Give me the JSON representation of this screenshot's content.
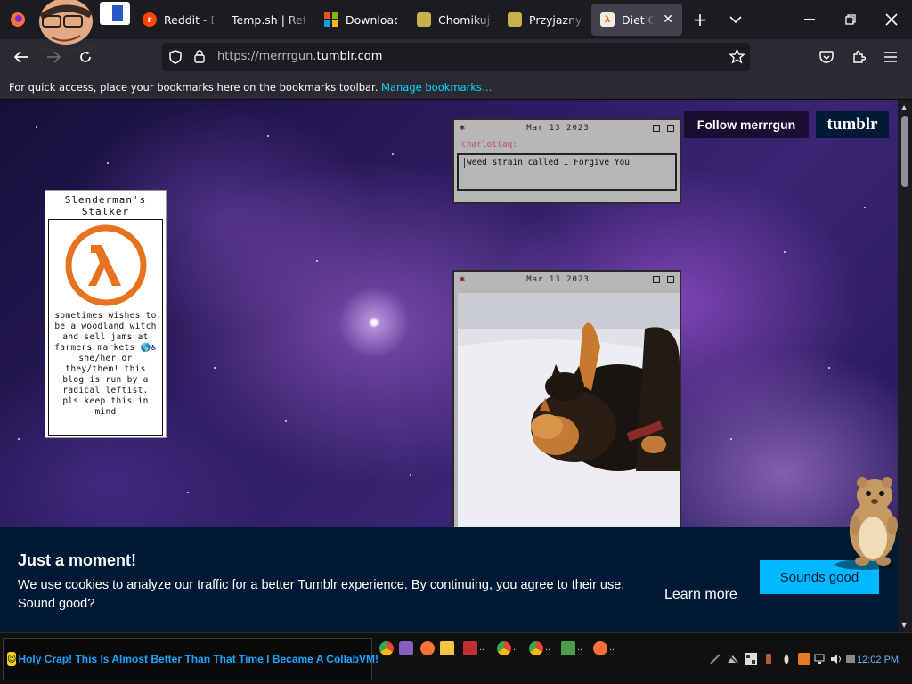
{
  "browser": {
    "tabs": [
      {
        "label": "Reddit - Dive into anything",
        "favicon": "reddit-icon",
        "color": "#ff4500"
      },
      {
        "label": "Temp.sh | Retro",
        "favicon": "tempsh-icon",
        "color": "#1c1b22"
      },
      {
        "label": "Download",
        "favicon": "microsoft-icon",
        "color": "#f25022"
      },
      {
        "label": "Chomikuj.pl",
        "favicon": "chomikuj-icon",
        "color": "#c8b14a"
      },
      {
        "label": "Przyjazny dysk",
        "favicon": "przyjazny-icon",
        "color": "#c8b14a"
      },
      {
        "label": "Diet Coke",
        "favicon": "halflife-icon",
        "color": "#e8e0d0",
        "active": true
      }
    ],
    "new_tab_label": "+",
    "url": {
      "prefix": "https://merrrgun.",
      "domain": "tumblr.com"
    },
    "bookmarks_text": "For quick access, place your bookmarks here on the bookmarks toolbar.",
    "bookmarks_link": "Manage bookmarks…"
  },
  "page": {
    "sidebar": {
      "title": "Slenderman's Stalker",
      "description": "sometimes wishes to be a woodland witch and sell jams at farmers markets 🌎♿ she/her or they/them! this blog is run by a radical leftist. pls keep this in mind"
    },
    "post1": {
      "date": "Mar 13 2023",
      "author": "charlottaq:",
      "quote": "weed strain called I Forgive You"
    },
    "post2": {
      "date": "Mar 13 2023"
    },
    "follow_label": "Follow merrrgun",
    "tumblr_logo": "tumblr",
    "cookie": {
      "title": "Just a moment!",
      "body": "We use cookies to analyze our traffic for a better Tumblr experience. By continuing, you agree to their use. Sound good?",
      "learn_more": "Learn more",
      "accept": "Sounds good"
    }
  },
  "taskbar": {
    "start_text": "Holy Crap! This Is Almost Better Than That Time I Became A CollabVM!",
    "apps": [
      {
        "name": "chrome-icon",
        "color": "#34a853",
        "label": ""
      },
      {
        "name": "visual-studio-icon",
        "color": "#865fc5",
        "label": ""
      },
      {
        "name": "firefox-icon",
        "color": "#ff7139",
        "label": ""
      },
      {
        "name": "file-explorer-icon",
        "color": "#f4c542",
        "label": ""
      },
      {
        "name": "app-icon",
        "color": "#c03030",
        "label": ".."
      },
      {
        "name": "chrome-icon",
        "color": "#34a853",
        "label": ".."
      },
      {
        "name": "chrome-icon",
        "color": "#34a853",
        "label": ".."
      },
      {
        "name": "app-icon",
        "color": "#4aa04a",
        "label": ".."
      },
      {
        "name": "firefox-icon",
        "color": "#ff7139",
        "label": ".."
      }
    ],
    "clock": "12:02 PM"
  },
  "colors": {
    "accent": "#00ddff",
    "tumblr_navy": "#001935",
    "tumblr_blue": "#00b8ff"
  }
}
